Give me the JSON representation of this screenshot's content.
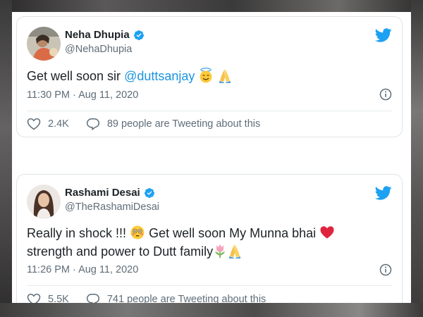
{
  "tweets": [
    {
      "name": "Neha Dhupia",
      "handle": "@NehaDhupia",
      "text_before": "Get well soon sir ",
      "mention": "@duttsanjay",
      "emojis": [
        "smiling-face-with-halo",
        "folded-hands"
      ],
      "time": "11:30 PM · Aug 11, 2020",
      "likes": "2.4K",
      "conversation": "89 people are Tweeting about this"
    },
    {
      "name": "Rashami Desai",
      "handle": "@TheRashamiDesai",
      "line1": "Really in shock !!! ",
      "line1_after": " Get well soon My Munna bhai ",
      "line2": "strength and power to Dutt family",
      "emojis": [
        "flushed-face",
        "red-heart",
        "tulip",
        "folded-hands"
      ],
      "time": "11:26 PM · Aug 11, 2020",
      "likes": "5.5K",
      "conversation": "741 people are Tweeting about this"
    }
  ],
  "colors": {
    "link": "#1b95e0",
    "verified": "#1da1f2",
    "muted": "#5f6d78",
    "heart": "#e0245e"
  }
}
